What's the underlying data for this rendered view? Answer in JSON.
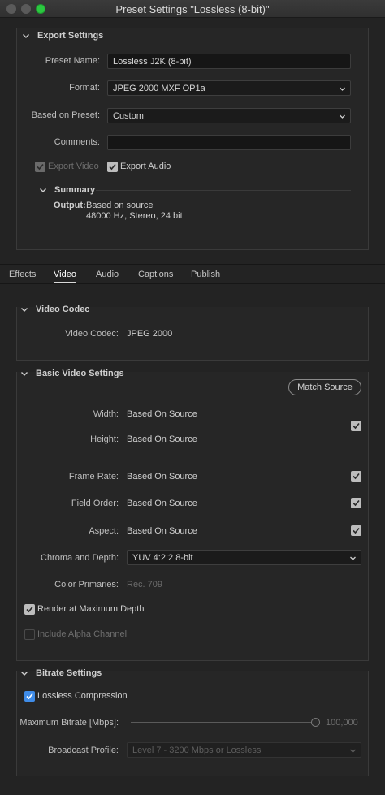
{
  "window": {
    "title": "Preset Settings \"Lossless (8-bit)\""
  },
  "export": {
    "heading": "Export Settings",
    "preset_name_label": "Preset Name:",
    "preset_name_value": "Lossless J2K (8-bit)",
    "format_label": "Format:",
    "format_value": "JPEG 2000 MXF OP1a",
    "based_on_label": "Based on Preset:",
    "based_on_value": "Custom",
    "comments_label": "Comments:",
    "comments_value": "",
    "export_video_label": "Export Video",
    "export_video_checked": true,
    "export_audio_label": "Export Audio",
    "export_audio_checked": true,
    "summary_heading": "Summary",
    "output_label": "Output:",
    "output_line1": "Based on source",
    "output_line2": "48000 Hz, Stereo, 24 bit"
  },
  "tabs": [
    "Effects",
    "Video",
    "Audio",
    "Captions",
    "Publish"
  ],
  "active_tab": "Video",
  "video_codec": {
    "heading": "Video Codec",
    "codec_label": "Video Codec:",
    "codec_value": "JPEG 2000"
  },
  "basic_video": {
    "heading": "Basic Video Settings",
    "match_source_label": "Match Source",
    "width_label": "Width:",
    "width_value": "Based On Source",
    "height_label": "Height:",
    "height_value": "Based On Source",
    "frame_rate_label": "Frame Rate:",
    "frame_rate_value": "Based On Source",
    "field_order_label": "Field Order:",
    "field_order_value": "Based On Source",
    "aspect_label": "Aspect:",
    "aspect_value": "Based On Source",
    "chroma_label": "Chroma and Depth:",
    "chroma_value": "YUV 4:2:2 8-bit",
    "color_primaries_label": "Color Primaries:",
    "color_primaries_value": "Rec. 709",
    "render_max_depth_label": "Render at Maximum Depth",
    "render_max_depth_checked": true,
    "alpha_label": "Include Alpha Channel",
    "alpha_checked": false
  },
  "bitrate": {
    "heading": "Bitrate Settings",
    "lossless_label": "Lossless Compression",
    "lossless_checked": true,
    "max_bitrate_label": "Maximum Bitrate [Mbps]:",
    "max_bitrate_value": "100,000",
    "max_bitrate_fraction": 1.0,
    "broadcast_label": "Broadcast Profile:",
    "broadcast_value": "Level 7 - 3200 Mbps or Lossless"
  },
  "colors": {
    "accent": "#3f8ce8",
    "background": "#232323"
  }
}
